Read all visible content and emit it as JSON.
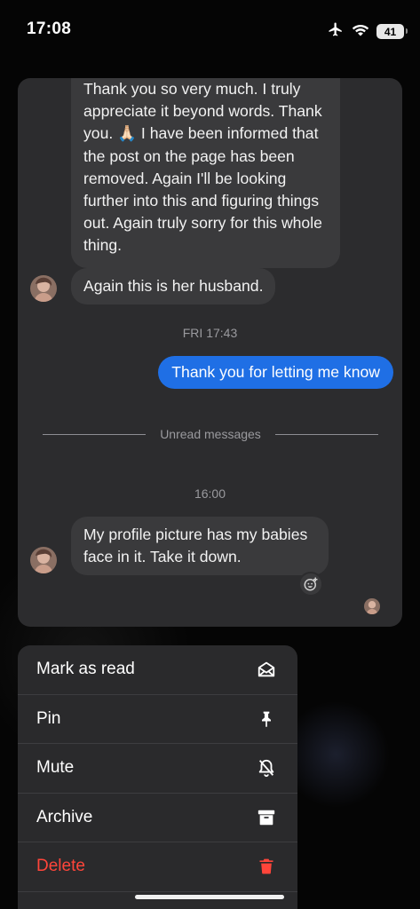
{
  "status_bar": {
    "time": "17:08",
    "battery": "41",
    "icons": [
      "airplane-icon",
      "wifi-icon",
      "battery-icon"
    ]
  },
  "chat": {
    "messages": [
      {
        "direction": "incoming",
        "text": "Thank you so very much. I truly appreciate it beyond words. Thank you. 🙏🏻 I have been informed that the post on the page has been removed. Again I'll be looking further into this and figuring things out. Again truly sorry for this whole thing."
      },
      {
        "direction": "incoming",
        "text": "Again this is her husband."
      },
      {
        "direction": "timestamp",
        "text": "FRI 17:43"
      },
      {
        "direction": "outgoing",
        "text": "Thank you for letting me know"
      },
      {
        "direction": "divider",
        "text": "Unread messages"
      },
      {
        "direction": "timestamp",
        "text": "16:00"
      },
      {
        "direction": "incoming",
        "text": "My profile picture has my babies face in it. Take it down."
      }
    ]
  },
  "menu": {
    "items": [
      {
        "label": "Mark as read",
        "icon": "envelope-open-icon",
        "danger": false
      },
      {
        "label": "Pin",
        "icon": "pin-icon",
        "danger": false
      },
      {
        "label": "Mute",
        "icon": "bell-slash-icon",
        "danger": false
      },
      {
        "label": "Archive",
        "icon": "archive-box-icon",
        "danger": false
      },
      {
        "label": "Delete",
        "icon": "trash-icon",
        "danger": true
      }
    ]
  },
  "colors": {
    "outgoing_bubble": "#1f6fe5",
    "incoming_bubble": "#3a3a3c",
    "card_background": "#2c2c2e",
    "danger": "#ff453a"
  }
}
